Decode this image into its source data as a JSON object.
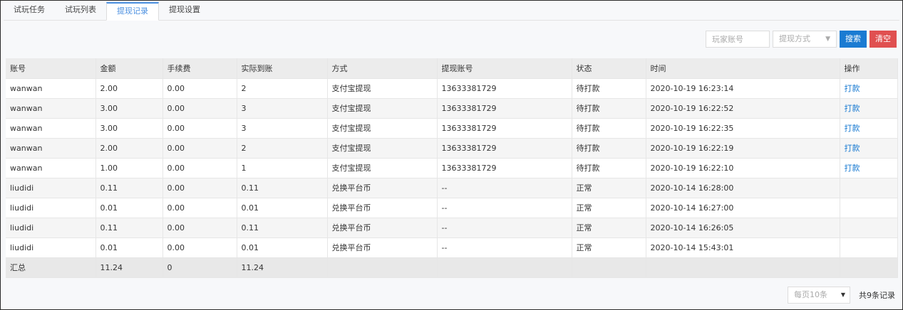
{
  "tabs": [
    {
      "label": "试玩任务"
    },
    {
      "label": "试玩列表"
    },
    {
      "label": "提现记录"
    },
    {
      "label": "提现设置"
    }
  ],
  "active_tab": 2,
  "toolbar": {
    "player_account_placeholder": "玩家账号",
    "withdraw_method_placeholder": "提现方式",
    "search_label": "搜索",
    "clear_label": "清空"
  },
  "table": {
    "headers": [
      "账号",
      "金额",
      "手续费",
      "实际到账",
      "方式",
      "提现账号",
      "状态",
      "时间",
      "操作"
    ],
    "rows": [
      [
        "wanwan",
        "2.00",
        "0.00",
        "2",
        "支付宝提现",
        "13633381729",
        "待打款",
        "2020-10-19 16:23:14",
        "打款"
      ],
      [
        "wanwan",
        "3.00",
        "0.00",
        "3",
        "支付宝提现",
        "13633381729",
        "待打款",
        "2020-10-19 16:22:52",
        "打款"
      ],
      [
        "wanwan",
        "3.00",
        "0.00",
        "3",
        "支付宝提现",
        "13633381729",
        "待打款",
        "2020-10-19 16:22:35",
        "打款"
      ],
      [
        "wanwan",
        "2.00",
        "0.00",
        "2",
        "支付宝提现",
        "13633381729",
        "待打款",
        "2020-10-19 16:22:19",
        "打款"
      ],
      [
        "wanwan",
        "1.00",
        "0.00",
        "1",
        "支付宝提现",
        "13633381729",
        "待打款",
        "2020-10-19 16:22:10",
        "打款"
      ],
      [
        "liudidi",
        "0.11",
        "0.00",
        "0.11",
        "兑换平台币",
        "--",
        "正常",
        "2020-10-14 16:28:00",
        ""
      ],
      [
        "liudidi",
        "0.01",
        "0.00",
        "0.01",
        "兑换平台币",
        "--",
        "正常",
        "2020-10-14 16:27:00",
        ""
      ],
      [
        "liudidi",
        "0.11",
        "0.00",
        "0.11",
        "兑换平台币",
        "--",
        "正常",
        "2020-10-14 16:26:05",
        ""
      ],
      [
        "liudidi",
        "0.01",
        "0.00",
        "0.01",
        "兑换平台币",
        "--",
        "正常",
        "2020-10-14 15:43:01",
        ""
      ]
    ],
    "summary": [
      "汇总",
      "11.24",
      "0",
      "11.24",
      "",
      "",
      "",
      "",
      ""
    ]
  },
  "pager": {
    "page_size_label": "每页10条",
    "total_label": "共9条记录"
  }
}
